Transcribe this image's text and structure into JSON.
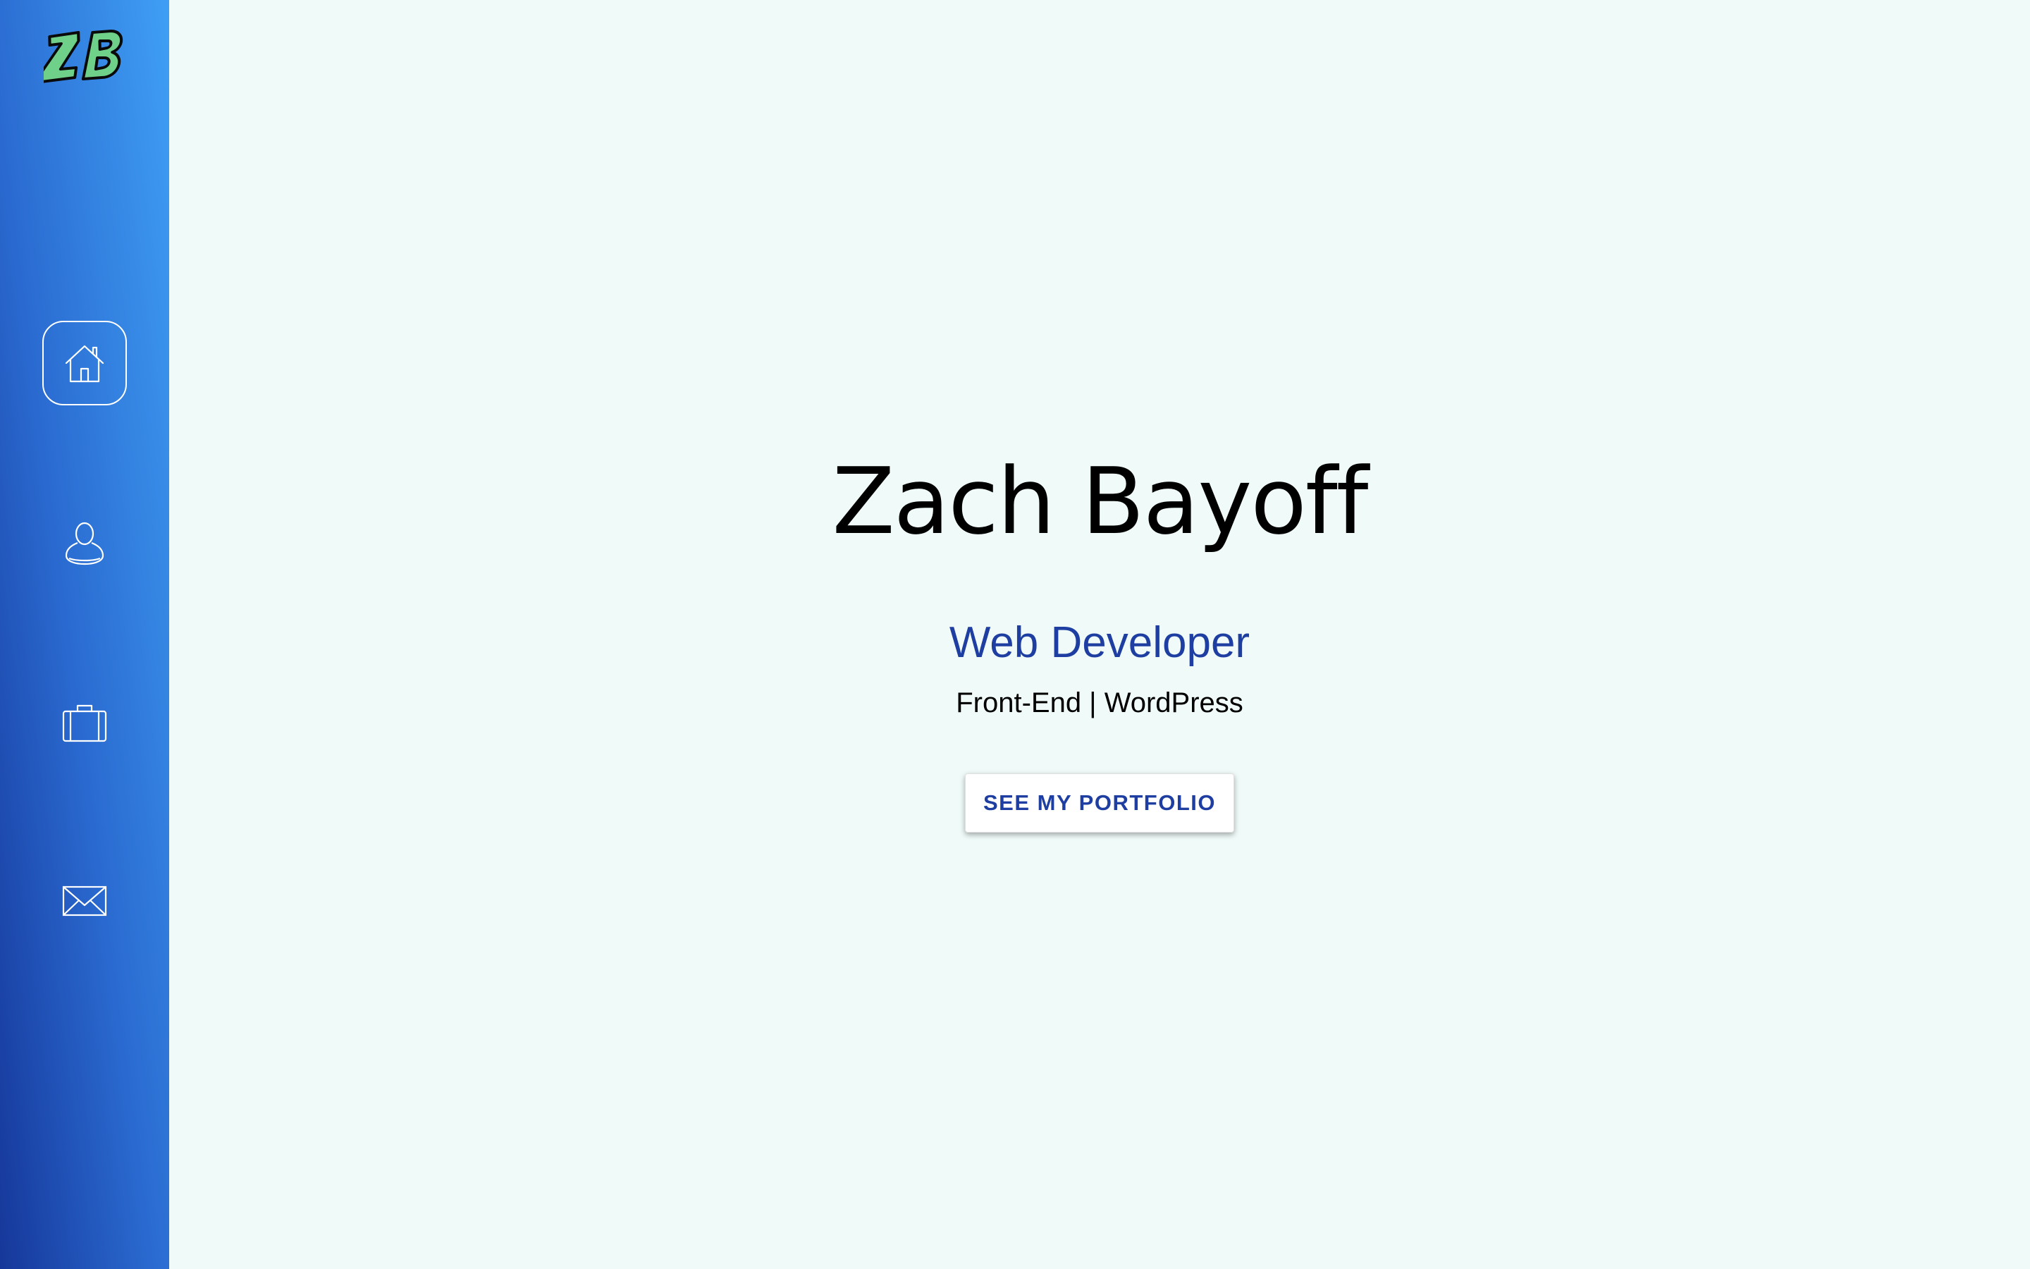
{
  "sidebar": {
    "logo_text": "ZB",
    "nav_items": [
      {
        "icon": "home-icon",
        "active": true
      },
      {
        "icon": "user-icon",
        "active": false
      },
      {
        "icon": "briefcase-icon",
        "active": false
      },
      {
        "icon": "mail-icon",
        "active": false
      }
    ]
  },
  "hero": {
    "name": "Zach Bayoff",
    "title": "Web Developer",
    "subtitle": "Front-End | WordPress",
    "cta_label": "SEE MY PORTFOLIO"
  },
  "colors": {
    "background": "#f0fbf9",
    "sidebar_gradient_start": "#16379a",
    "sidebar_gradient_end": "#3f9ff5",
    "accent": "#1e3ea1",
    "logo_fill": "#6fd08a"
  }
}
